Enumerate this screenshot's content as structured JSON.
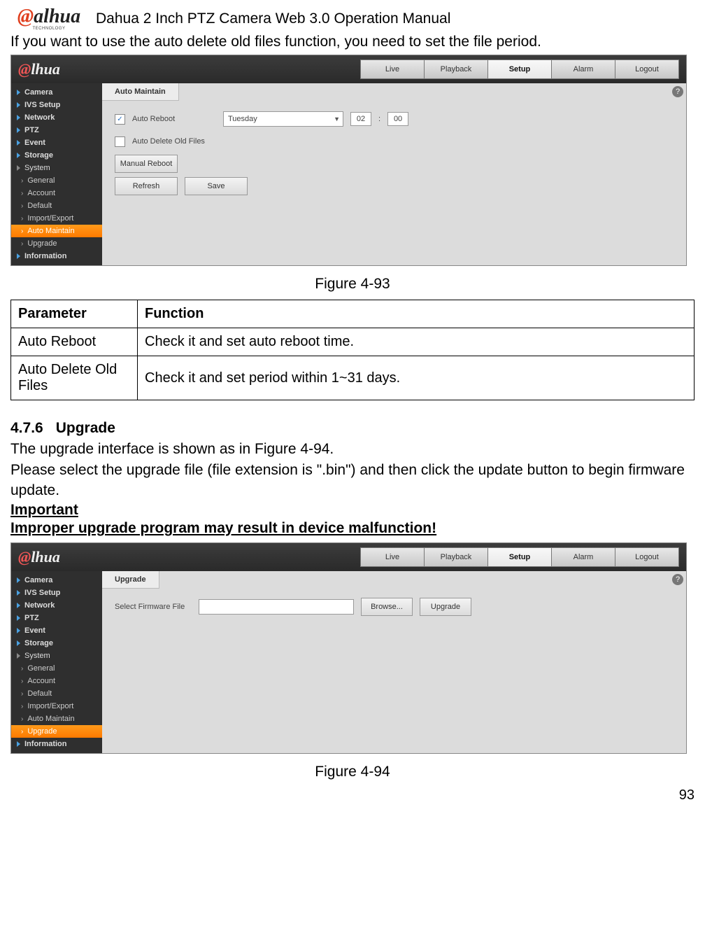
{
  "header": {
    "logo_text": "alhua",
    "logo_sub": "TECHNOLOGY",
    "title": "Dahua 2 Inch PTZ Camera Web 3.0 Operation Manual"
  },
  "intro": "If you want to use the auto delete old files function, you need to set the file period.",
  "nav_tabs": [
    "Live",
    "Playback",
    "Setup",
    "Alarm",
    "Logout"
  ],
  "sidebar_main": [
    "Camera",
    "IVS Setup",
    "Network",
    "PTZ",
    "Event",
    "Storage",
    "System"
  ],
  "sidebar_sub": [
    "General",
    "Account",
    "Default",
    "Import/Export",
    "Auto Maintain",
    "Upgrade"
  ],
  "sidebar_tail": "Information",
  "figure93": {
    "panel_title": "Auto Maintain",
    "auto_reboot_label": "Auto Reboot",
    "auto_reboot_checked": "✓",
    "day_value": "Tuesday",
    "hour_value": "02",
    "minute_value": "00",
    "time_sep": ":",
    "auto_delete_label": "Auto Delete Old Files",
    "manual_reboot_btn": "Manual Reboot",
    "refresh_btn": "Refresh",
    "save_btn": "Save",
    "caption": "Figure 4-93",
    "active_sub": "Auto Maintain"
  },
  "param_table": {
    "h_param": "Parameter",
    "h_func": "Function",
    "rows": [
      {
        "param": "Auto Reboot",
        "func": "Check it and set auto reboot time."
      },
      {
        "param": "Auto Delete Old Files",
        "func": "Check it and set period within 1~31 days."
      }
    ]
  },
  "section_476": {
    "num": "4.7.6",
    "title": "Upgrade",
    "p1": "The upgrade interface is shown as in Figure 4-94.",
    "p2": "Please select the upgrade file (file extension is \".bin\") and then click the update button to begin firmware update.",
    "important_label": "Important",
    "warning": "Improper upgrade program may result in device malfunction!"
  },
  "figure94": {
    "panel_title": "Upgrade",
    "select_file_label": "Select Firmware File",
    "browse_btn": "Browse...",
    "upgrade_btn": "Upgrade",
    "caption": "Figure 4-94",
    "active_sub": "Upgrade"
  },
  "help_symbol": "?",
  "page_number": "93"
}
